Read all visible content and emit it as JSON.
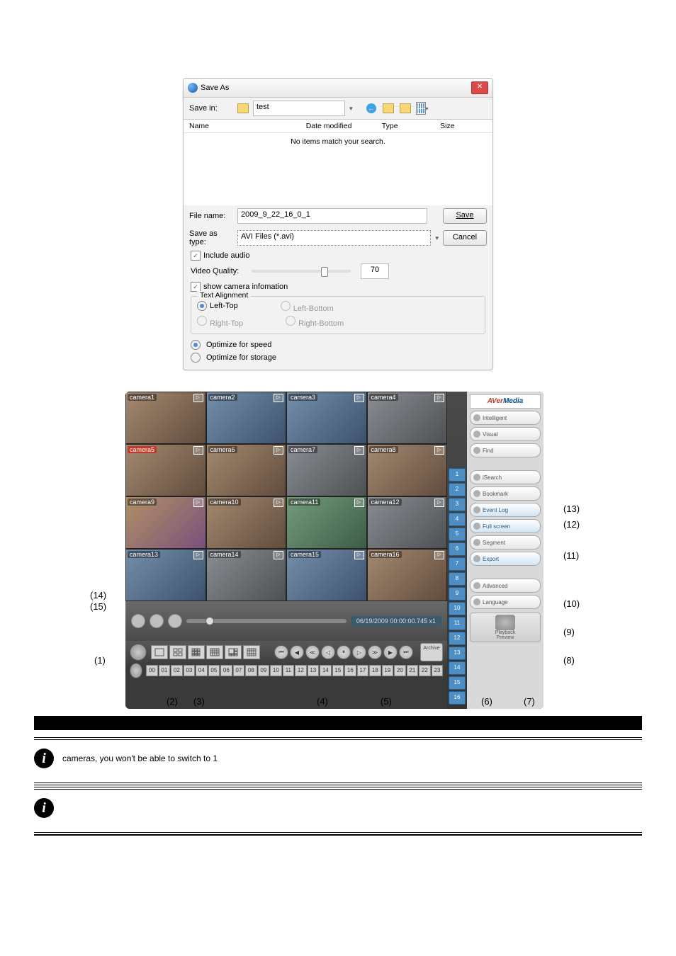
{
  "dialog": {
    "title": "Save As",
    "close": "✕",
    "savein_label": "Save in:",
    "savein_value": "test",
    "caret": "▾",
    "col_name": "Name",
    "col_date": "Date modified",
    "col_type": "Type",
    "col_size": "Size",
    "no_items": "No items match your search.",
    "filename_label": "File name:",
    "filename_value": "2009_9_22_16_0_1",
    "saveastype_label": "Save as type:",
    "saveastype_value": "AVI Files (*.avi)",
    "save_btn": "Save",
    "cancel_btn": "Cancel",
    "include_audio": "Include audio",
    "video_quality": "Video Quality:",
    "quality_value": "70",
    "show_cam_info": "show camera infomation",
    "text_alignment": "Text Alignment",
    "radio_lt": "Left-Top",
    "radio_rt": "Right-Top",
    "radio_lb": "Left-Bottom",
    "radio_rb": "Right-Bottom",
    "opt_speed": "Optimize for speed",
    "opt_storage": "Optimize for storage"
  },
  "app": {
    "logo": "AVerMedia",
    "cameras": [
      "camera1",
      "camera2",
      "camera3",
      "camera4",
      "camera5",
      "camera6",
      "camera7",
      "camera8",
      "camera9",
      "camera10",
      "camera11",
      "camera12",
      "camera13",
      "camera14",
      "camera15",
      "camera16"
    ],
    "play_glyph": "▷",
    "timestamp": "06/19/2009 00:00:00.745   x1",
    "side_buttons": [
      "Intelligent",
      "Visual",
      "Find",
      "iSearch",
      "Bookmark",
      "Event Log",
      "Full screen",
      "Segment",
      "Export",
      "Advanced",
      "Language"
    ],
    "numbers": [
      "1",
      "2",
      "3",
      "4",
      "5",
      "6",
      "7",
      "8",
      "9",
      "10",
      "11",
      "12",
      "13",
      "14",
      "15",
      "16"
    ],
    "archive": "Archive",
    "preview": "Preview",
    "playback": "Playback",
    "pb_glyphs": [
      "⏮",
      "◀",
      "≪",
      "◁",
      "⏸",
      "▷",
      "≫",
      "▶",
      "⏭"
    ],
    "hours": [
      "00",
      "01",
      "02",
      "03",
      "04",
      "05",
      "06",
      "07",
      "08",
      "09",
      "10",
      "11",
      "12",
      "13",
      "14",
      "15",
      "16",
      "17",
      "18",
      "19",
      "20",
      "21",
      "22",
      "23"
    ]
  },
  "callouts": {
    "c1": "(1)",
    "c2": "(2)",
    "c3": "(3)",
    "c4": "(4)",
    "c5": "(5)",
    "c6": "(6)",
    "c7": "(7)",
    "c8": "(8)",
    "c9": "(9)",
    "c10": "(10)",
    "c11": "(11)",
    "c12": "(12)",
    "c13": "(13)",
    "c14": "(14)",
    "c15": "(15)"
  },
  "notes": {
    "note1": "cameras, you won't be able to switch to 1"
  }
}
